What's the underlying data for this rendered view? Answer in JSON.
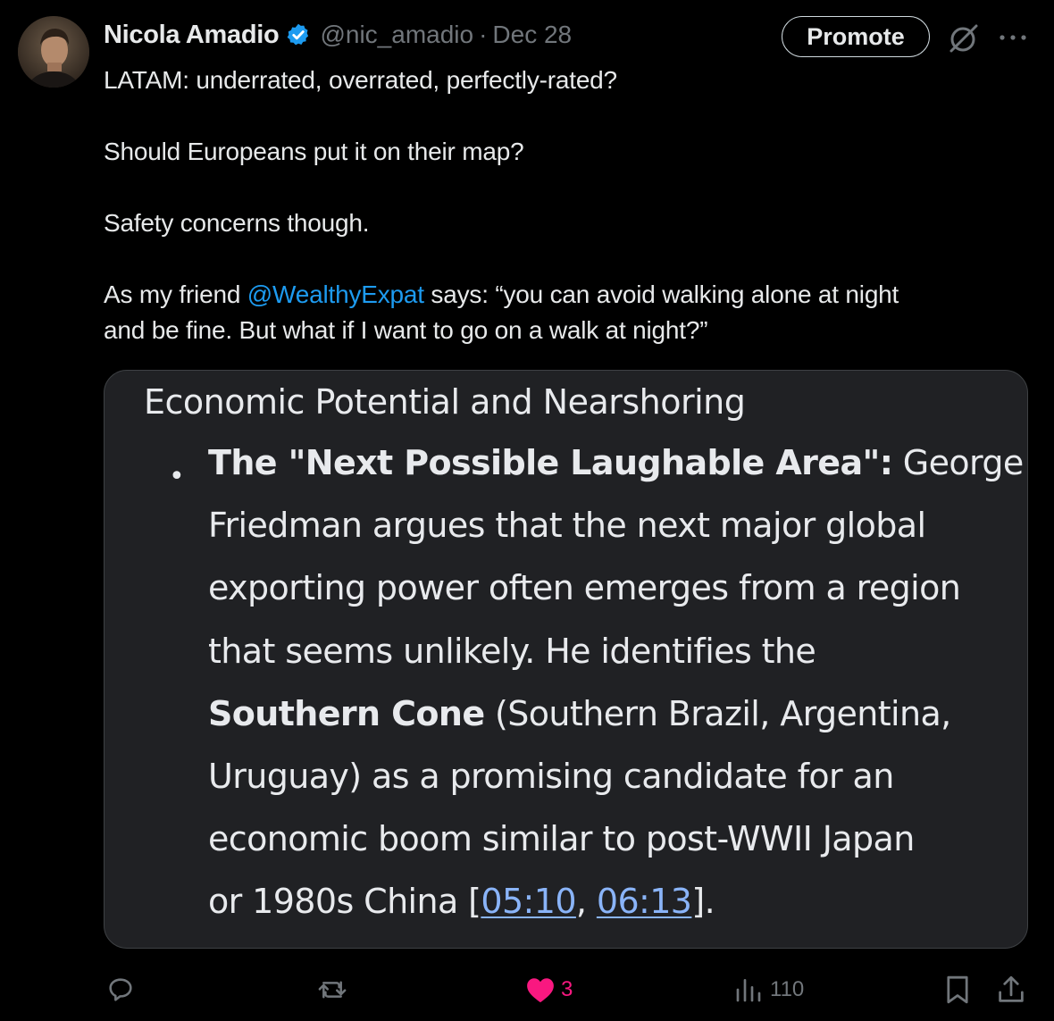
{
  "author": {
    "display_name": "Nicola Amadio",
    "handle": "@nic_amadio",
    "separator": "·",
    "date": "Dec 28",
    "avatar_icon": "avatar-photo",
    "verified_icon": "verified-badge-icon"
  },
  "header_actions": {
    "promote_label": "Promote",
    "grok_icon": "grok-icon",
    "more_icon": "more-icon"
  },
  "tweet": {
    "line1": "LATAM: underrated, overrated, perfectly-rated?",
    "line2": "Should Europeans put it on their map?",
    "line3": "Safety concerns though.",
    "line4_prefix": "As my friend ",
    "mention": "@WealthyExpat",
    "line4_suffix": " says: “you can avoid walking alone at night",
    "line5": "and be fine. But what if I want to go on a walk at night?”"
  },
  "card": {
    "heading": "Economic Potential and Nearshoring",
    "bullet": "•",
    "term": "The \"Next Possible Laughable Area\":",
    "l1_rest": " George",
    "l2": "Friedman argues that the next major global",
    "l3": "exporting power often emerges from a region",
    "l4": "that seems unlikely. He identifies the",
    "l5_bold": "Southern Cone",
    "l5_rest": " (Southern Brazil, Argentina,",
    "l6": "Uruguay) as a promising candidate for an",
    "l7": "economic boom similar to post-WWII Japan",
    "l8_prefix": "or 1980s China [",
    "cite1": "05:10",
    "cite_sep": ", ",
    "cite2": "06:13",
    "l8_suffix": "]."
  },
  "actions": {
    "reply_icon": "reply-icon",
    "repost_icon": "repost-icon",
    "like_icon": "heart-icon",
    "like_count": "3",
    "views_icon": "views-icon",
    "views_count": "110",
    "bookmark_icon": "bookmark-icon",
    "share_icon": "share-icon"
  },
  "colors": {
    "background": "#000000",
    "text": "#e7e9ea",
    "muted": "#71767b",
    "link": "#1d9bf0",
    "verified": "#1d9bf0",
    "like": "#f91880",
    "card_background": "#202124",
    "citation": "#8ab4f8"
  }
}
